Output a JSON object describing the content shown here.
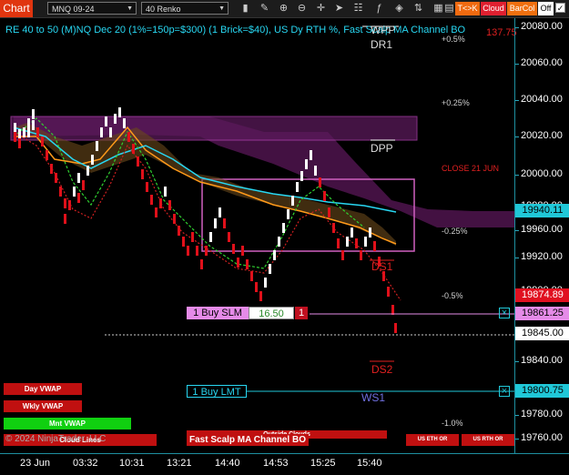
{
  "toolbar": {
    "app_title": "Chart",
    "instrument": "MNQ 09-24",
    "bar_type": "40 Renko",
    "tk_label": "T<>K",
    "cloud_label": "Cloud",
    "barcol_label": "BarCol",
    "off_label": "Off",
    "checkbox_mark": "✓"
  },
  "header": {
    "description": "RE 40 to 50 (M)NQ Dec 20 (1%=150p=$300) (1 Brick=$40), US Dy RTH %, Fast Scalp MA Channel BO",
    "top_red_value": "137.75"
  },
  "levels": {
    "wpp": "WPP",
    "dr1": "DR1",
    "dpp": "DPP",
    "ds1": "DS1",
    "ds2": "DS2",
    "ws1": "WS1",
    "close": "CLOSE 21 JUN"
  },
  "percent_labels": {
    "p05": "+0.5%",
    "p025": "+0.25%",
    "m025": "-0.25%",
    "m05": "-0.5%",
    "m10": "-1.0%"
  },
  "price_axis": {
    "ticks": [
      "20080.00",
      "20060.00",
      "20040.00",
      "20020.00",
      "20000.00",
      "19980.00",
      "19960.00",
      "19920.00",
      "19900.00",
      "19840.00",
      "19820.00",
      "19780.00",
      "19760.00"
    ],
    "tags": [
      {
        "value": "19940.11",
        "bg": "#20c8d8",
        "fg": "#000000"
      },
      {
        "value": "19874.89",
        "bg": "#e01020",
        "fg": "#ffffff"
      },
      {
        "value": "19861.25",
        "bg": "#e58be8",
        "fg": "#000000"
      },
      {
        "value": "19845.00",
        "bg": "#ffffff",
        "fg": "#000000"
      },
      {
        "value": "19800.75",
        "bg": "#20c8d8",
        "fg": "#000000"
      }
    ]
  },
  "time_axis": [
    "23 Jun",
    "03:32",
    "10:31",
    "13:21",
    "14:40",
    "14:53",
    "15:25",
    "15:40"
  ],
  "orders": {
    "slm_label": "1 Buy SLM",
    "slm_offset": "16.50",
    "slm_qty": "1",
    "lmt_label": "1 Buy LMT",
    "close_mark": "×"
  },
  "buttons": {
    "day_vwap": "Day VWAP",
    "wkly_vwap": "Wkly VWAP",
    "mnt_vwap": "Mnt VWAP",
    "copyright": "© 2024 NinjaTrader, LLC",
    "outside_clouds": "Outside Clouds",
    "cloud_lines": "Cloud Lines",
    "fast_scalp": "Fast Scalp MA Channel BO",
    "us_eth_or": "US ETH OR",
    "us_rth_or": "US RTH OR"
  },
  "colors": {
    "accent": "#e0350f",
    "cyan": "#28d7f2",
    "up_brick": "#ffffff",
    "down_brick": "#e0101a",
    "magenta": "#b040b0"
  }
}
